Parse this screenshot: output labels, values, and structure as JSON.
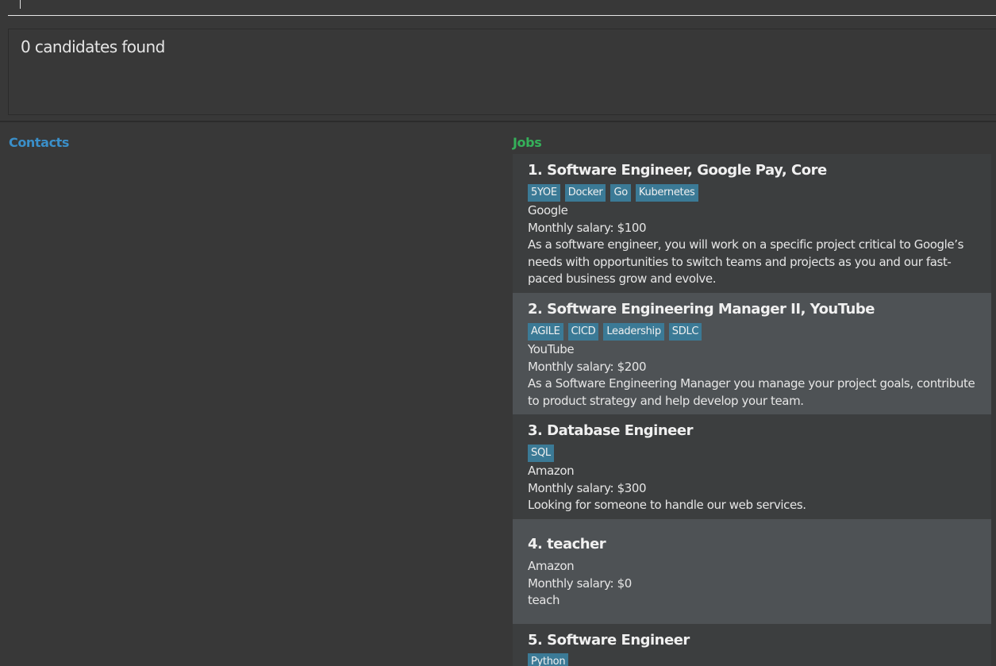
{
  "command": {
    "value": ""
  },
  "result": {
    "text": "0 candidates found"
  },
  "panels": {
    "contacts_title": "Contacts",
    "jobs_title": "Jobs"
  },
  "jobs": [
    {
      "index_title": "1. Software Engineer, Google Pay, Core",
      "tags": [
        "5YOE",
        "Docker",
        "Go",
        "Kubernetes"
      ],
      "company": "Google",
      "salary": "Monthly salary: $100",
      "description": "As a software engineer, you will work on a specific project critical to Google’s needs with opportunities to switch teams and projects as you and our fast-paced business grow and evolve."
    },
    {
      "index_title": "2. Software Engineering Manager II, YouTube",
      "tags": [
        "AGILE",
        "CICD",
        "Leadership",
        "SDLC"
      ],
      "company": "YouTube",
      "salary": "Monthly salary: $200",
      "description": "As a Software Engineering Manager you manage your project goals, contribute to product strategy and help develop your team."
    },
    {
      "index_title": "3. Database Engineer",
      "tags": [
        "SQL"
      ],
      "company": "Amazon",
      "salary": "Monthly salary: $300",
      "description": "Looking for someone to handle our web services."
    },
    {
      "index_title": "4. teacher",
      "tags": [],
      "company": "Amazon",
      "salary": "Monthly salary: $0",
      "description": "teach"
    },
    {
      "index_title": "5. Software Engineer",
      "tags": [
        "Python"
      ],
      "company": "",
      "salary": "",
      "description": ""
    }
  ],
  "colors": {
    "background": "#383838",
    "contacts_title": "#3a8fc9",
    "jobs_title": "#35b05a",
    "tag": "#3b7a96",
    "card_odd": "#3c3e3f",
    "card_even": "#4e5255"
  }
}
